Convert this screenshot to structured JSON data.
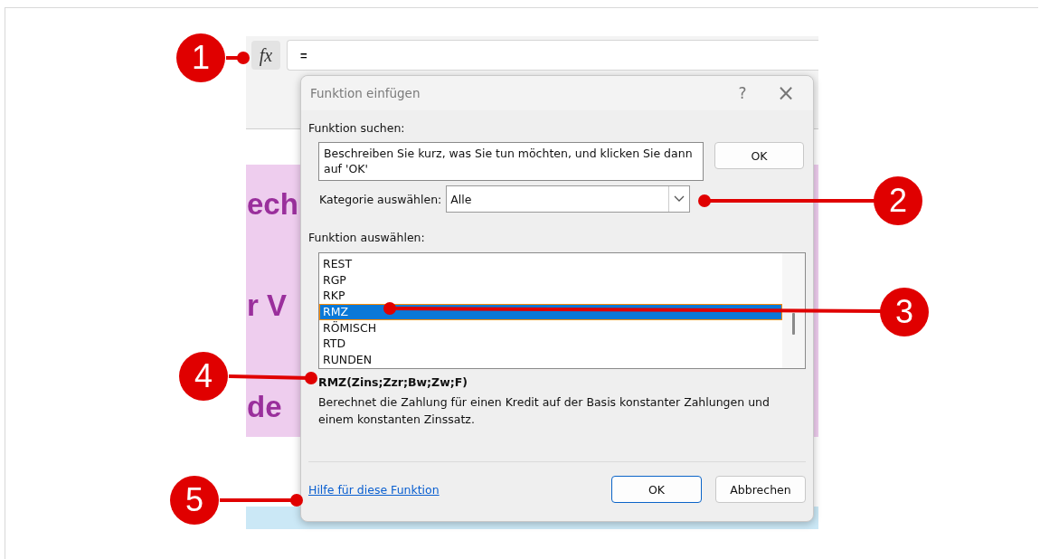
{
  "callouts": [
    {
      "number": "1"
    },
    {
      "number": "2"
    },
    {
      "number": "3"
    },
    {
      "number": "4"
    },
    {
      "number": "5"
    }
  ],
  "formula_bar": {
    "fx_label": "fx",
    "value": "="
  },
  "sheet": {
    "texts": [
      "ech",
      "r V",
      "de"
    ]
  },
  "dialog": {
    "title": "Funktion einfügen",
    "help": "?",
    "close": "×",
    "search_label": "Funktion suchen:",
    "search_value": "Beschreiben Sie kurz, was Sie tun möchten, und klicken Sie dann auf 'OK'",
    "search_button": "OK",
    "category_label": "Kategorie auswählen:",
    "category_value": "Alle",
    "list_label": "Funktion auswählen:",
    "functions": [
      {
        "name": "REST",
        "selected": false
      },
      {
        "name": "RGP",
        "selected": false
      },
      {
        "name": "RKP",
        "selected": false
      },
      {
        "name": "RMZ",
        "selected": true
      },
      {
        "name": "RÖMISCH",
        "selected": false
      },
      {
        "name": "RTD",
        "selected": false
      },
      {
        "name": "RUNDEN",
        "selected": false
      }
    ],
    "signature": "RMZ(Zins;Zzr;Bw;Zw;F)",
    "description": "Berechnet die Zahlung für einen Kredit auf der Basis konstanter Zahlungen und einem konstanten Zinssatz.",
    "help_link": "Hilfe für diese Funktion",
    "ok": "OK",
    "cancel": "Abbrechen"
  }
}
